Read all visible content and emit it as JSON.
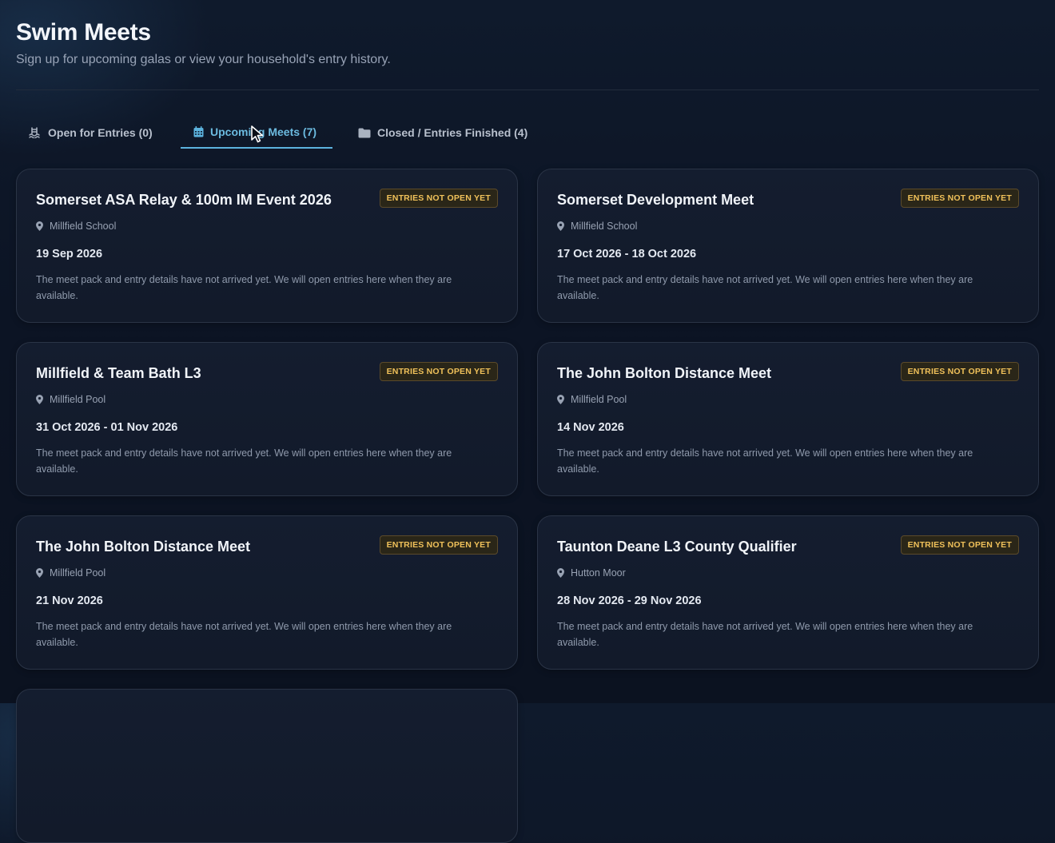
{
  "header": {
    "title": "Swim Meets",
    "subtitle": "Sign up for upcoming galas or view your household's entry history."
  },
  "tabs": [
    {
      "label": "Open for Entries (0)",
      "icon": "pool-ladder-icon",
      "active": false
    },
    {
      "label": "Upcoming Meets (7)",
      "icon": "calendar-icon",
      "active": true
    },
    {
      "label": "Closed / Entries Finished (4)",
      "icon": "folder-icon",
      "active": false
    }
  ],
  "meets": [
    {
      "name": "Somerset ASA Relay & 100m IM Event 2026",
      "badge": "ENTRIES NOT OPEN YET",
      "venue": "Millfield School",
      "date": "19 Sep 2026",
      "note": "The meet pack and entry details have not arrived yet. We will open entries here when they are available."
    },
    {
      "name": "Somerset Development Meet",
      "badge": "ENTRIES NOT OPEN YET",
      "venue": "Millfield School",
      "date": "17 Oct 2026 - 18 Oct 2026",
      "note": "The meet pack and entry details have not arrived yet. We will open entries here when they are available."
    },
    {
      "name": "Millfield & Team Bath L3",
      "badge": "ENTRIES NOT OPEN YET",
      "venue": "Millfield Pool",
      "date": "31 Oct 2026 - 01 Nov 2026",
      "note": "The meet pack and entry details have not arrived yet. We will open entries here when they are available."
    },
    {
      "name": "The John Bolton Distance Meet",
      "badge": "ENTRIES NOT OPEN YET",
      "venue": "Millfield Pool",
      "date": "14 Nov 2026",
      "note": "The meet pack and entry details have not arrived yet. We will open entries here when they are available."
    },
    {
      "name": "The John Bolton Distance Meet",
      "badge": "ENTRIES NOT OPEN YET",
      "venue": "Millfield Pool",
      "date": "21 Nov 2026",
      "note": "The meet pack and entry details have not arrived yet. We will open entries here when they are available."
    },
    {
      "name": "Taunton Deane L3 County Qualifier",
      "badge": "ENTRIES NOT OPEN YET",
      "venue": "Hutton Moor",
      "date": "28 Nov 2026 - 29 Nov 2026",
      "note": "The meet pack and entry details have not arrived yet. We will open entries here when they are available."
    }
  ],
  "colors": {
    "accent": "#5cb3de",
    "badge_text": "#f0c15a",
    "background": "#0c1424"
  }
}
